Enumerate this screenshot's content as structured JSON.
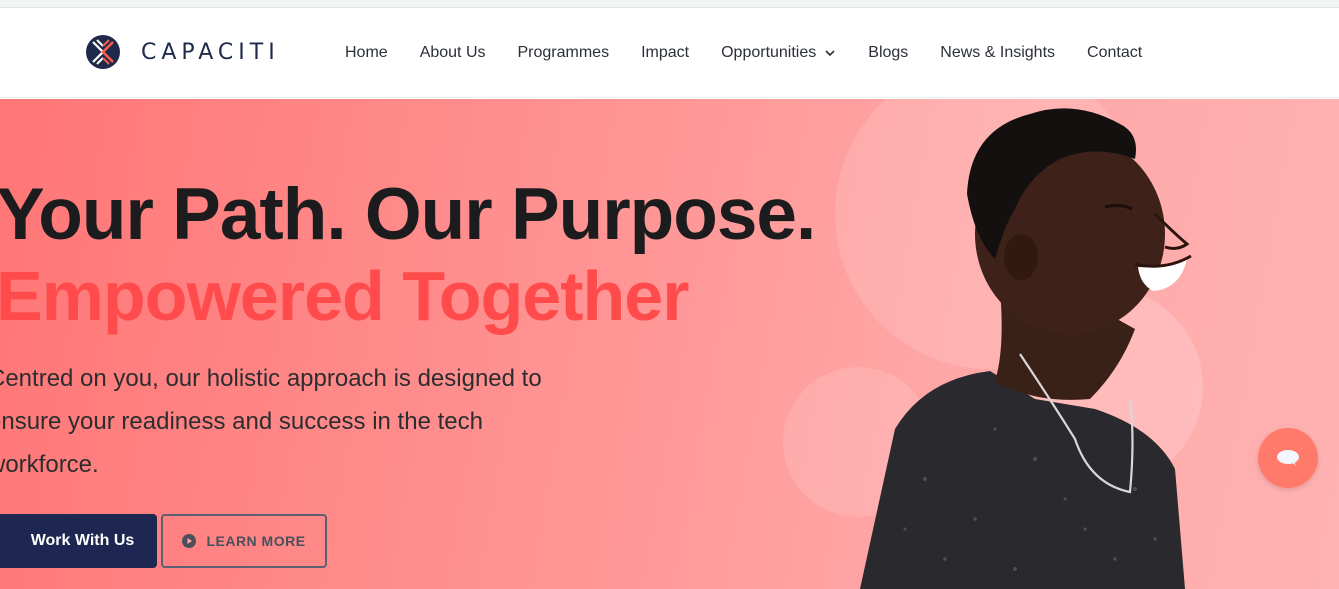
{
  "brand": {
    "name": "CAPACITI",
    "logo_icon": "capaciti-x-logo",
    "colors": {
      "navy": "#1e2a4a",
      "accent": "#ff4b4b"
    }
  },
  "nav": {
    "items": [
      {
        "label": "Home"
      },
      {
        "label": "About Us"
      },
      {
        "label": "Programmes"
      },
      {
        "label": "Impact"
      },
      {
        "label": "Opportunities",
        "icon": "chevron-down-icon"
      },
      {
        "label": "Blogs"
      },
      {
        "label": "News & Insights"
      },
      {
        "label": "Contact"
      }
    ]
  },
  "hero": {
    "headline": "Your Path. Our Purpose.",
    "subheadline": "Empowered Together",
    "description": "Centred on you, our holistic approach is designed to ensure your readiness and success in the tech workforce.",
    "primary_button": "Work With Us",
    "secondary_button": "LEARN MORE",
    "secondary_icon": "play-circle-icon",
    "image": "smiling-young-man-photo"
  },
  "chat": {
    "icon": "chat-bubble-icon"
  }
}
